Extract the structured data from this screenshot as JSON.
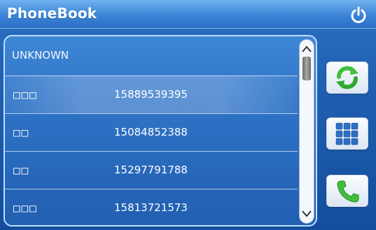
{
  "app": {
    "title": "PhoneBook"
  },
  "contacts": {
    "group_label": "UNKNOWN",
    "items": [
      {
        "name": "□□□",
        "number": "15889539395",
        "selected": true
      },
      {
        "name": "□□",
        "number": "15084852388",
        "selected": false
      },
      {
        "name": "□□",
        "number": "15297791788",
        "selected": false
      },
      {
        "name": "□□□",
        "number": "15813721573",
        "selected": false
      }
    ]
  },
  "icons": {
    "power": "power-icon",
    "scroll_up": "scroll-up-arrow-icon",
    "scroll_down": "scroll-down-arrow-icon",
    "refresh": "refresh-icon",
    "dialpad": "dialpad-icon",
    "call": "phone-call-icon"
  },
  "colors": {
    "background": "#1f5fb1",
    "title_bar": "#3b84d6",
    "text": "#ffffff",
    "accent_green": "#3fbf3a",
    "keypad_blue": "#2f6fc4"
  }
}
